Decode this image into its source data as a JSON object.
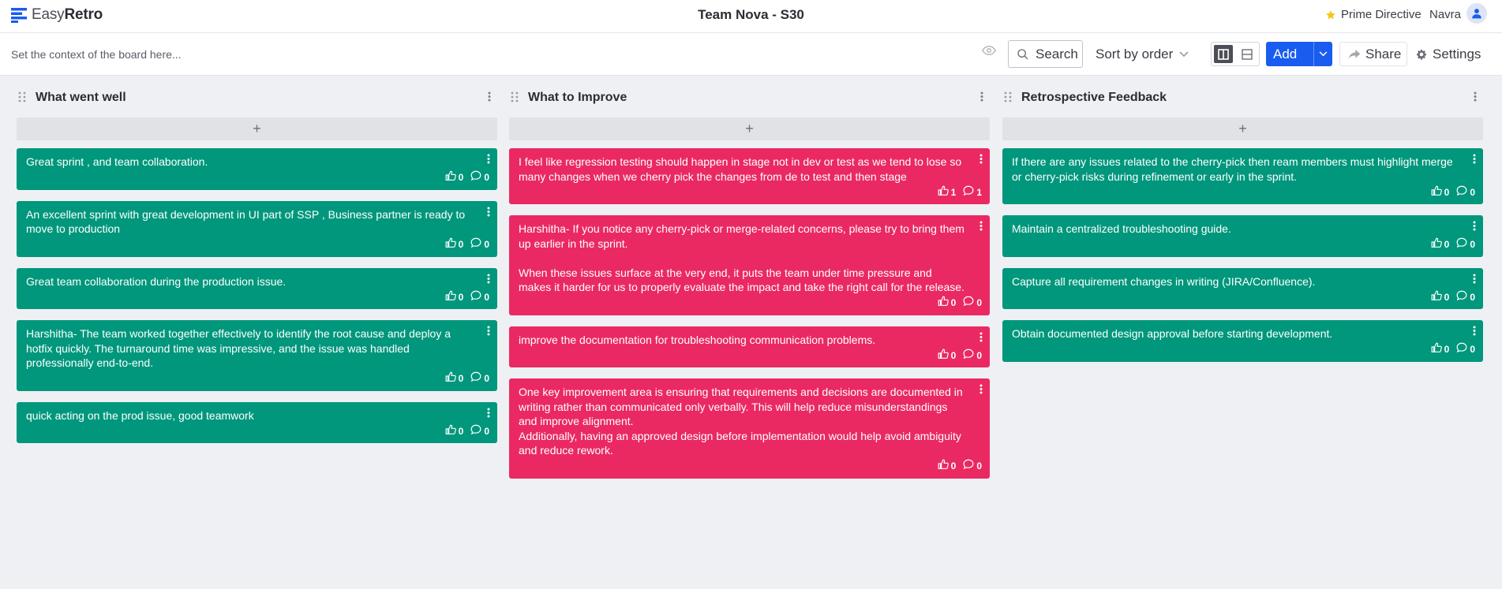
{
  "header": {
    "logo_light": "Easy",
    "logo_bold": "Retro",
    "board_title": "Team Nova - S30",
    "prime_directive": "Prime Directive",
    "user_name": "Navra"
  },
  "toolbar": {
    "context_placeholder": "Set the context of the board here...",
    "search_label": "Search",
    "sort_label": "Sort by order",
    "add_label": "Add",
    "share_label": "Share",
    "settings_label": "Settings"
  },
  "colors": {
    "green_card": "#00977c",
    "pink_card": "#ea2962",
    "add_button": "#1a5cf0",
    "star": "#f5c518"
  },
  "columns": [
    {
      "title": "What went well",
      "color": "green",
      "cards": [
        {
          "text": "Great sprint , and team collaboration.",
          "likes": "0",
          "comments": "0"
        },
        {
          "text": "An excellent sprint with great development in UI part of SSP , Business partner is ready to move to production",
          "likes": "0",
          "comments": "0"
        },
        {
          "text": "Great team collaboration during the production issue.",
          "likes": "0",
          "comments": "0"
        },
        {
          "text": "Harshitha- The team worked together effectively to identify the root cause and deploy a hotfix quickly. The turnaround time was impressive, and the issue was handled professionally end-to-end.",
          "likes": "0",
          "comments": "0"
        },
        {
          "text": "quick acting on the prod issue, good teamwork",
          "likes": "0",
          "comments": "0"
        }
      ]
    },
    {
      "title": "What to Improve",
      "color": "pink",
      "cards": [
        {
          "text": "I feel like regression testing should happen in stage not in dev or test as we tend to lose so many changes when we cherry pick the changes from de to test and then stage",
          "likes": "1",
          "comments": "1"
        },
        {
          "text": "Harshitha- If you notice any cherry-pick or merge-related concerns, please try to bring them up earlier in the sprint.\n\nWhen these issues surface at the very end, it puts the team under time pressure and makes it harder for us to properly evaluate the impact and take the right call for the release.",
          "likes": "0",
          "comments": "0"
        },
        {
          "text": "improve the documentation for troubleshooting communication problems.",
          "likes": "0",
          "comments": "0"
        },
        {
          "text": "One key improvement area is ensuring that requirements and decisions are documented in writing rather than communicated only verbally. This will help reduce misunderstandings and improve alignment.\nAdditionally, having an approved design before implementation would help avoid ambiguity and reduce rework.",
          "likes": "0",
          "comments": "0"
        }
      ]
    },
    {
      "title": "Retrospective Feedback",
      "color": "green",
      "cards": [
        {
          "text": "If there are any issues related to the cherry-pick then ream members must highlight merge or cherry-pick risks during refinement or early in the sprint.",
          "likes": "0",
          "comments": "0"
        },
        {
          "text": "Maintain a centralized troubleshooting guide.",
          "likes": "0",
          "comments": "0"
        },
        {
          "text": "Capture all requirement changes in writing (JIRA/Confluence).",
          "likes": "0",
          "comments": "0"
        },
        {
          "text": "Obtain documented design approval before starting development.",
          "likes": "0",
          "comments": "0"
        }
      ]
    }
  ]
}
